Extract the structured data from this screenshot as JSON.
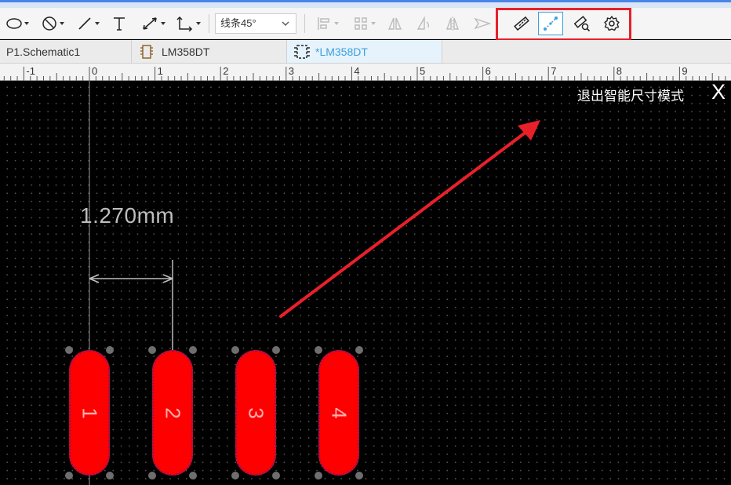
{
  "toolbar": {
    "line_mode_value": "线条45°",
    "tools_left": [
      "ellipse-icon",
      "no-symbol-icon",
      "line-icon",
      "text-icon",
      "dimension-arrow-icon",
      "corner-line-icon"
    ],
    "tools_disabled": [
      "align-left-icon",
      "distribute-icon",
      "flip-horizontal-icon",
      "rotate-icon",
      "mirror-icon",
      "send-icon"
    ],
    "tools_right": [
      "ruler-icon",
      "smart-dimension-icon",
      "measure-search-icon",
      "settings-gear-icon"
    ],
    "highlight_color": "#e8202a",
    "active_tool_color": "#3ba0e0"
  },
  "tabs": [
    {
      "label": "P1.Schematic1",
      "icon": null,
      "active": false
    },
    {
      "label": "LM358DT",
      "icon": "chip-icon",
      "active": false
    },
    {
      "label": "*LM358DT",
      "icon": "footprint-icon",
      "active": true
    }
  ],
  "ruler": {
    "labels": [
      "-1",
      "0",
      "1",
      "2",
      "3",
      "4",
      "5",
      "6",
      "7",
      "8",
      "9"
    ]
  },
  "canvas": {
    "exit_label": "退出智能尺寸模式",
    "exit_close": "X",
    "dimension_text": "1.270mm",
    "pad_color": "#ff0000",
    "pads": [
      "1",
      "2",
      "3",
      "4"
    ]
  }
}
